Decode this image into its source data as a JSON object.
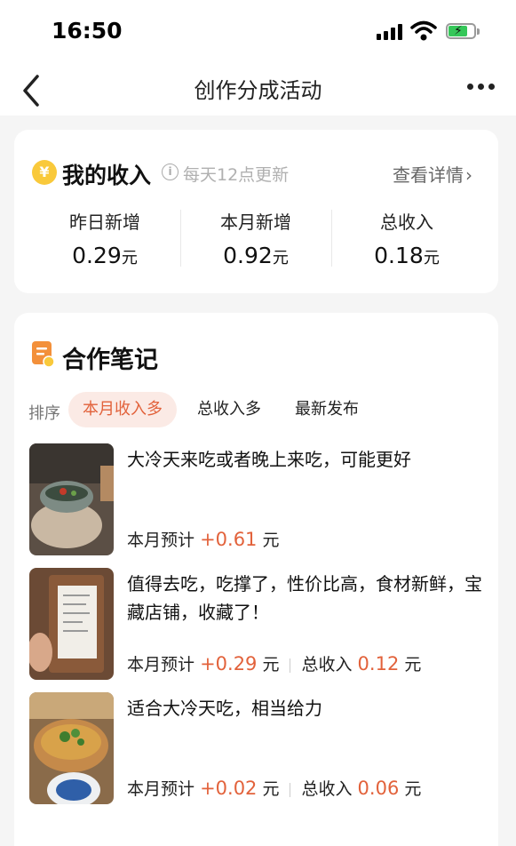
{
  "status": {
    "time": "16:50"
  },
  "nav": {
    "title": "创作分成活动"
  },
  "income": {
    "coin_symbol": "¥",
    "title": "我的收入",
    "info_symbol": "i",
    "update_note": "每天12点更新",
    "detail_link": "查看详情",
    "detail_chevron": "›",
    "stats": [
      {
        "label": "昨日新增",
        "value": "0.29",
        "unit": "元"
      },
      {
        "label": "本月新增",
        "value": "0.92",
        "unit": "元"
      },
      {
        "label": "总收入",
        "value": "0.18",
        "unit": "元"
      }
    ]
  },
  "notes": {
    "title": "合作笔记",
    "sort_label": "排序",
    "sort_tabs": [
      "本月收入多",
      "总收入多",
      "最新发布"
    ],
    "active_tab": "本月收入多",
    "items": [
      {
        "title": "大冷天来吃或者晚上来吃，可能更好",
        "month_label": "本月预计",
        "month_value": "+0.61",
        "unit": "元"
      },
      {
        "title": "值得去吃，吃撑了，性价比高，食材新鲜，宝藏店铺，收藏了！",
        "month_label": "本月预计",
        "month_value": "+0.29",
        "unit": "元",
        "total_label": "总收入",
        "total_value": "0.12"
      },
      {
        "title": "适合大冷天吃，相当给力",
        "month_label": "本月预计",
        "month_value": "+0.02",
        "unit": "元",
        "total_label": "总收入",
        "total_value": "0.06"
      }
    ]
  },
  "colors": {
    "accent": "#e2623b",
    "accent_bg": "#fbeae5",
    "coin": "#f9c93b",
    "battery": "#35c759"
  },
  "icons": [
    "signal-icon",
    "wifi-icon",
    "battery-icon",
    "back-icon",
    "more-icon",
    "coin-icon",
    "info-icon",
    "notes-icon"
  ]
}
